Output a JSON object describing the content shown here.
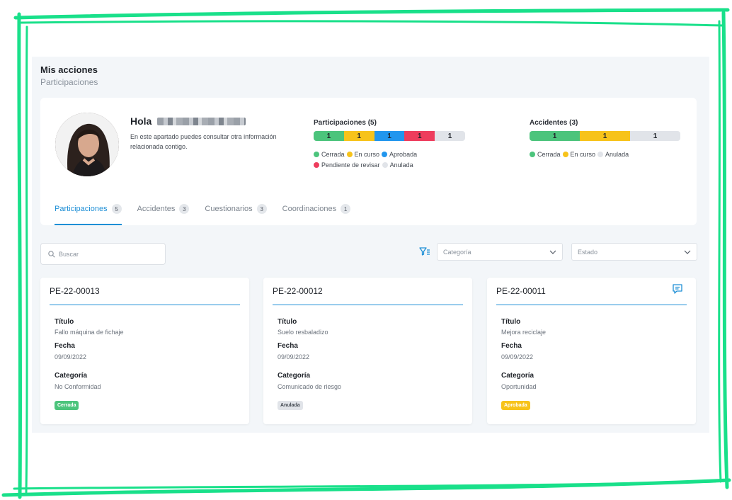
{
  "header": {
    "title": "Mis acciones",
    "subtitle": "Participaciones"
  },
  "profile": {
    "greeting": "Hola",
    "intro": "En este apartado puedes consultar otra información relacionada contigo."
  },
  "participaciones_stats": {
    "title": "Participaciones (5)",
    "segments": [
      {
        "value": "1",
        "color": "#4cc47c"
      },
      {
        "value": "1",
        "color": "#f7c31a"
      },
      {
        "value": "1",
        "color": "#2196ee"
      },
      {
        "value": "1",
        "color": "#ee3d5d"
      },
      {
        "value": "1",
        "color": "#e1e4e9"
      }
    ],
    "legend": [
      {
        "label": "Cerrada",
        "color": "#4cc47c"
      },
      {
        "label": "En curso",
        "color": "#f7c31a"
      },
      {
        "label": "Aprobada",
        "color": "#2196ee"
      },
      {
        "label": "Pendiente de revisar",
        "color": "#ee3d5d"
      },
      {
        "label": "Anulada",
        "color": "#e1e4e9"
      }
    ]
  },
  "accidentes_stats": {
    "title": "Accidentes (3)",
    "segments": [
      {
        "value": "1",
        "color": "#4cc47c"
      },
      {
        "value": "1",
        "color": "#f7c31a"
      },
      {
        "value": "1",
        "color": "#e1e4e9"
      }
    ],
    "legend": [
      {
        "label": "Cerrada",
        "color": "#4cc47c"
      },
      {
        "label": "En curso",
        "color": "#f7c31a"
      },
      {
        "label": "Anulada",
        "color": "#e1e4e9"
      }
    ]
  },
  "tabs": [
    {
      "label": "Participaciones",
      "count": "5",
      "active": true
    },
    {
      "label": "Accidentes",
      "count": "3",
      "active": false
    },
    {
      "label": "Cuestionarios",
      "count": "3",
      "active": false
    },
    {
      "label": "Coordinaciones",
      "count": "1",
      "active": false
    }
  ],
  "filters": {
    "search_placeholder": "Buscar",
    "categoria_placeholder": "Categoría",
    "estado_placeholder": "Estado"
  },
  "field_labels": {
    "titulo": "Título",
    "fecha": "Fecha",
    "categoria": "Categoría"
  },
  "cards": [
    {
      "code": "PE-22-00013",
      "titulo": "Fallo máquina de fichaje",
      "fecha": "09/09/2022",
      "categoria": "No Conformidad",
      "status": "Cerrada",
      "status_bg": "#4cc47c",
      "status_fg": "#ffffff",
      "has_comment_icon": false
    },
    {
      "code": "PE-22-00012",
      "titulo": "Suelo resbaladizo",
      "fecha": "09/09/2022",
      "categoria": "Comunicado de riesgo",
      "status": "Anulada",
      "status_bg": "#e1e4e9",
      "status_fg": "#444a52",
      "has_comment_icon": false
    },
    {
      "code": "PE-22-00011",
      "titulo": "Mejora reciclaje",
      "fecha": "09/09/2022",
      "categoria": "Oportunidad",
      "status": "Aprobada",
      "status_bg": "#f7c31a",
      "status_fg": "#ffffff",
      "has_comment_icon": true
    }
  ],
  "colors": {
    "accent": "#1e8fd6",
    "frame": "#19e08a"
  }
}
